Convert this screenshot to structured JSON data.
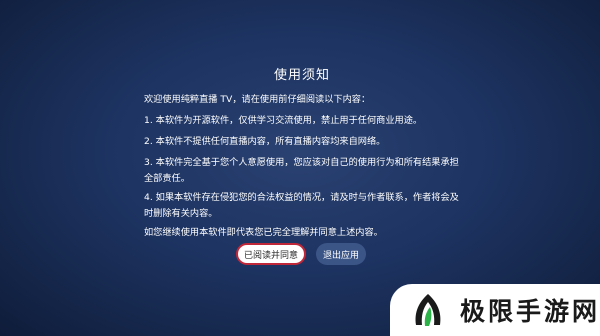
{
  "notice": {
    "title": "使用须知",
    "intro": "欢迎使用纯粹直播 TV，请在使用前仔细阅读以下内容：",
    "items": [
      "1. 本软件为开源软件，仅供学习交流使用，禁止用于任何商业用途。",
      "2. 本软件不提供任何直播内容，所有直播内容均来自网络。",
      "3. 本软件完全基于您个人意愿使用，您应该对自己的使用行为和所有结果承担全部责任。",
      "4. 如果本软件存在侵犯您的合法权益的情况，请及时与作者联系，作者将会及时删除有关内容。"
    ],
    "closing": "如您继续使用本软件即代表您已完全理解并同意上述内容。",
    "agree_label": "已阅读并同意",
    "exit_label": "退出应用"
  },
  "watermark": {
    "text": "极限手游网",
    "logo_icon": "leaf-logo-icon",
    "logo_colors": [
      "#1a1a1a",
      "#2db24a"
    ]
  },
  "colors": {
    "background": "#1d3361",
    "agree_border": "#c0283a",
    "exit_bg": "#3b5587"
  }
}
